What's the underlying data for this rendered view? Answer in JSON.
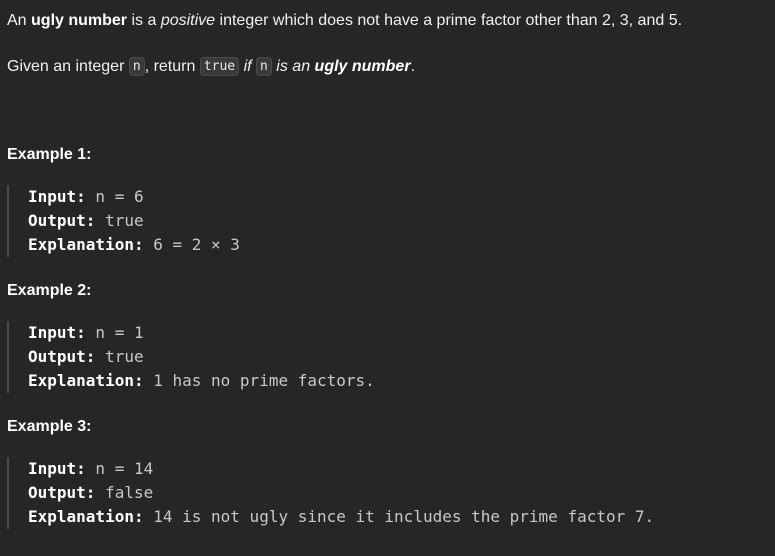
{
  "description": {
    "p1": {
      "an": "An ",
      "ugly_number": "ugly number",
      "is_a": " is a ",
      "positive": "positive",
      "rest": " integer which does not have a prime factor other than 2, 3, and 5."
    },
    "p2": {
      "given": "Given an integer ",
      "n_code": "n",
      "return": ", return ",
      "true_code": "true",
      "if": " if ",
      "n_code2": "n",
      "is_an": " is an ",
      "ugly_number": "ugly number",
      "period": "."
    }
  },
  "examples": [
    {
      "title": "Example 1:",
      "input_label": "Input:",
      "input_value": " n = 6",
      "output_label": "Output:",
      "output_value": " true",
      "explanation_label": "Explanation:",
      "explanation_value": " 6 = 2 × 3"
    },
    {
      "title": "Example 2:",
      "input_label": "Input:",
      "input_value": " n = 1",
      "output_label": "Output:",
      "output_value": " true",
      "explanation_label": "Explanation:",
      "explanation_value": " 1 has no prime factors."
    },
    {
      "title": "Example 3:",
      "input_label": "Input:",
      "input_value": " n = 14",
      "output_label": "Output:",
      "output_value": " false",
      "explanation_label": "Explanation:",
      "explanation_value": " 14 is not ugly since it includes the prime factor 7."
    }
  ]
}
